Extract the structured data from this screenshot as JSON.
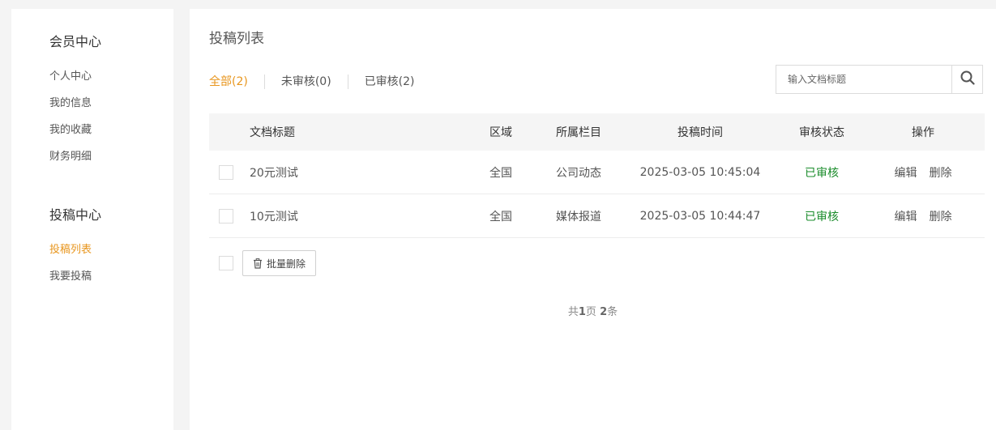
{
  "sidebar": {
    "member_center": {
      "title": "会员中心",
      "items": [
        "个人中心",
        "我的信息",
        "我的收藏",
        "财务明细"
      ]
    },
    "submission_center": {
      "title": "投稿中心",
      "items": [
        "投稿列表",
        "我要投稿"
      ],
      "active_item": "投稿列表"
    }
  },
  "main": {
    "title": "投稿列表",
    "tabs": [
      {
        "label": "全部(2)",
        "active": true
      },
      {
        "label": "未审核(0)",
        "active": false
      },
      {
        "label": "已审核(2)",
        "active": false
      }
    ],
    "search": {
      "placeholder": "输入文档标题",
      "value": ""
    },
    "table": {
      "headers": [
        "文档标题",
        "区域",
        "所属栏目",
        "投稿时间",
        "审核状态",
        "操作"
      ],
      "rows": [
        {
          "title": "20元测试",
          "region": "全国",
          "column": "公司动态",
          "time": "2025-03-05 10:45:04",
          "status": "已审核",
          "edit": "编辑",
          "delete": "删除"
        },
        {
          "title": "10元测试",
          "region": "全国",
          "column": "媒体报道",
          "time": "2025-03-05 10:44:47",
          "status": "已审核",
          "edit": "编辑",
          "delete": "删除"
        }
      ]
    },
    "batch_delete_label": "批量删除",
    "pagination": {
      "prefix": "共",
      "pages": "1",
      "page_unit": "页",
      "count": "2",
      "count_unit": "条"
    }
  },
  "colors": {
    "accent": "#e8961e",
    "status_ok": "#1a8c2b"
  },
  "icons": {
    "search": "search-icon",
    "trash": "trash-icon"
  }
}
